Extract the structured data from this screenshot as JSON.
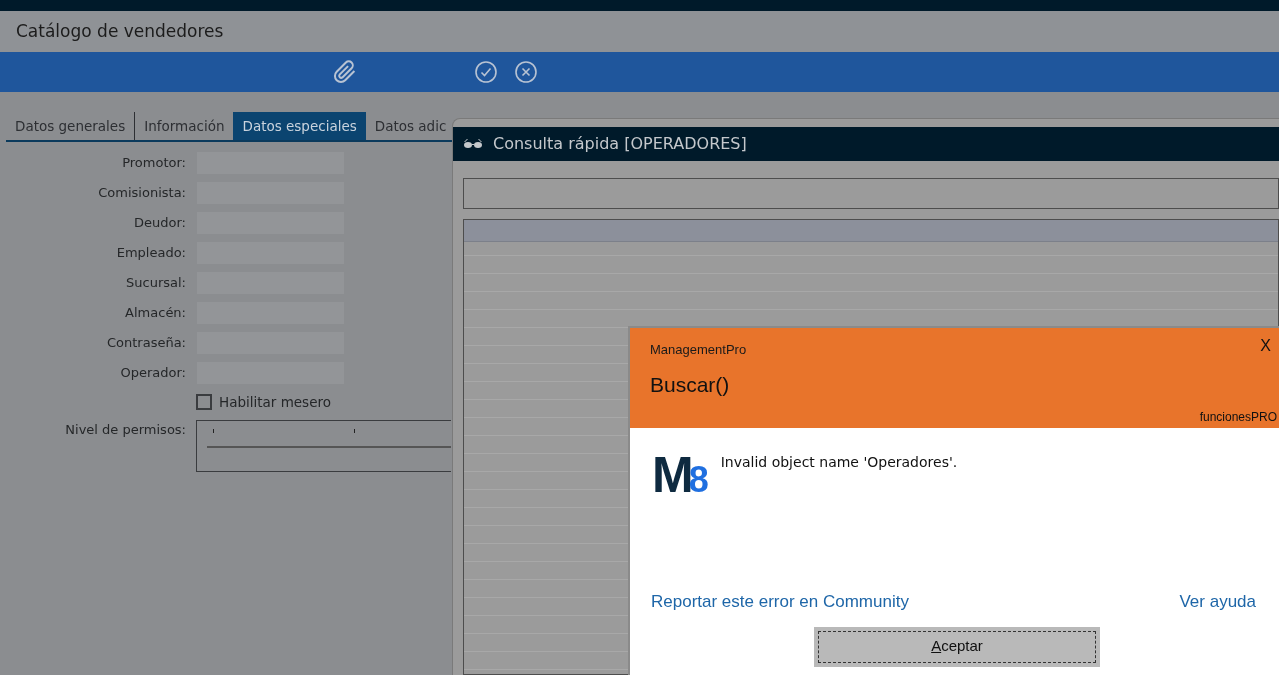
{
  "window": {
    "title": "Catálogo de vendedores"
  },
  "tabs": [
    {
      "label": "Datos generales",
      "selected": false
    },
    {
      "label": "Información",
      "selected": false
    },
    {
      "label": "Datos especiales",
      "selected": true
    },
    {
      "label": "Datos adic",
      "selected": false
    }
  ],
  "fields": [
    {
      "label": "Promotor:"
    },
    {
      "label": "Comisionista:"
    },
    {
      "label": "Deudor:"
    },
    {
      "label": "Empleado:"
    },
    {
      "label": "Sucursal:"
    },
    {
      "label": "Almacén:"
    },
    {
      "label": "Contraseña:"
    },
    {
      "label": "Operador:"
    }
  ],
  "checkbox": {
    "label": "Habilitar mesero",
    "checked": false
  },
  "permissions": {
    "label": "Nivel de permisos:"
  },
  "lookup_window": {
    "title": "Consulta rápida [OPERADORES]"
  },
  "error_dialog": {
    "app": "ManagementPro",
    "close": "X",
    "title": "Buscar()",
    "source": "funcionesPRO",
    "logo": {
      "letter": "M",
      "digit": "8"
    },
    "message": "Invalid object name 'Operadores'.",
    "report_link": "Reportar este error en Community",
    "help_link": "Ver ayuda",
    "button": {
      "access_key": "A",
      "rest": "ceptar"
    }
  }
}
